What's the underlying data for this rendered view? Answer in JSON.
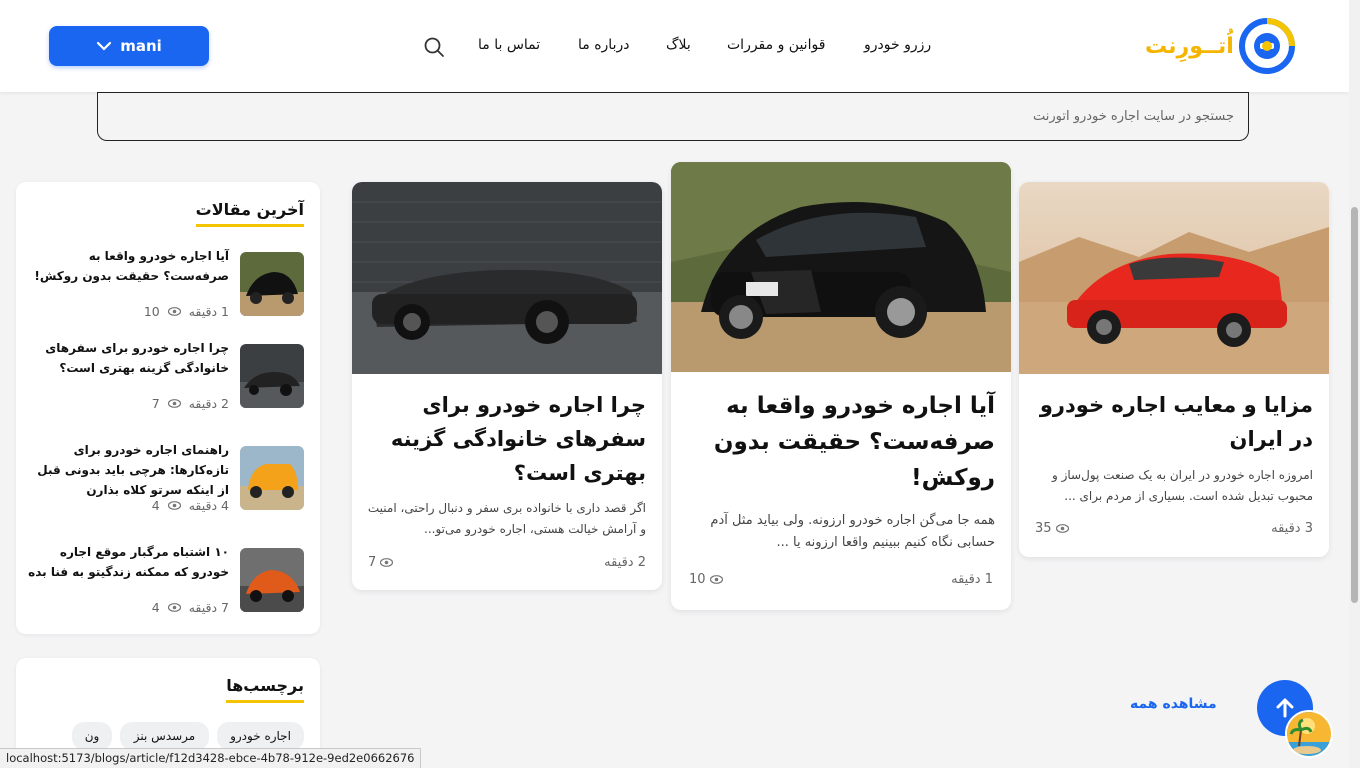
{
  "header": {
    "logo_text": "اُتــورِنت",
    "nav": {
      "reserve": "رزرو خودرو",
      "rules": "قوانین و مقررات",
      "blog": "بلاگ",
      "about": "درباره ما",
      "contact": "تماس با ما"
    },
    "user_label": "mani",
    "search_icon": "search-icon"
  },
  "search": {
    "placeholder": "جستجو در سایت اجاره خودرو اتورنت"
  },
  "cards": [
    {
      "title": "مزایا و معایب اجاره خودرو در ایران",
      "excerpt": "امروزه اجاره خودرو در ایران به یک صنعت پول‌ساز و محبوب تبدیل شده است. بسیاری از مردم برای ...",
      "read_time": "3 دقیقه",
      "views": "35"
    },
    {
      "title": "آیا اجاره خودرو واقعا به صرفه‌ست؟ حقیقت بدون روکش!",
      "excerpt": "همه جا می‌گن اجاره خودرو ارزونه. ولی بیاید مثل آدم حسابی نگاه کنیم ببینیم واقعا ارزونه یا ...",
      "read_time": "1 دقیقه",
      "views": "10"
    },
    {
      "title": "چرا اجاره خودرو برای سفرهای خانوادگی گزینه بهتری است؟",
      "excerpt": "اگر قصد داری با خانواده بری سفر و دنبال راحتی، امنیت و آرامش خیالت هستی، اجاره خودرو می‌تو...",
      "read_time": "2 دقیقه",
      "views": "7"
    }
  ],
  "sidebar": {
    "latest_title": "آخرین مقالات",
    "articles": [
      {
        "title": "آیا اجاره خودرو واقعا به صرفه‌ست؟ حقیقت بدون روکش!",
        "read_time": "1 دقیقه",
        "views": "10"
      },
      {
        "title": "چرا اجاره خودرو برای سفرهای خانوادگی گزینه بهتری است؟",
        "read_time": "2 دقیقه",
        "views": "7"
      },
      {
        "title": "راهنمای اجاره خودرو برای تازه‌کارها: هرچی باید بدونی قبل از اینکه سرتو کلاه بذارن",
        "read_time": "4 دقیقه",
        "views": "4"
      },
      {
        "title": "۱۰ اشتباه مرگبار موقع اجاره خودرو که ممکنه زندگیتو به فنا بده",
        "read_time": "7 دقیقه",
        "views": "4"
      }
    ],
    "tags_title": "برچسب‌ها",
    "tags": [
      "اجاره خودرو",
      "مرسدس بنز",
      "ون"
    ]
  },
  "view_all": "مشاهده همه",
  "status_url": "localhost:5173/blogs/article/f12d3428-ebce-4b78-912e-9ed2e0662676",
  "colors": {
    "brand_blue": "#1a66f0",
    "brand_yellow": "#f4c400"
  }
}
